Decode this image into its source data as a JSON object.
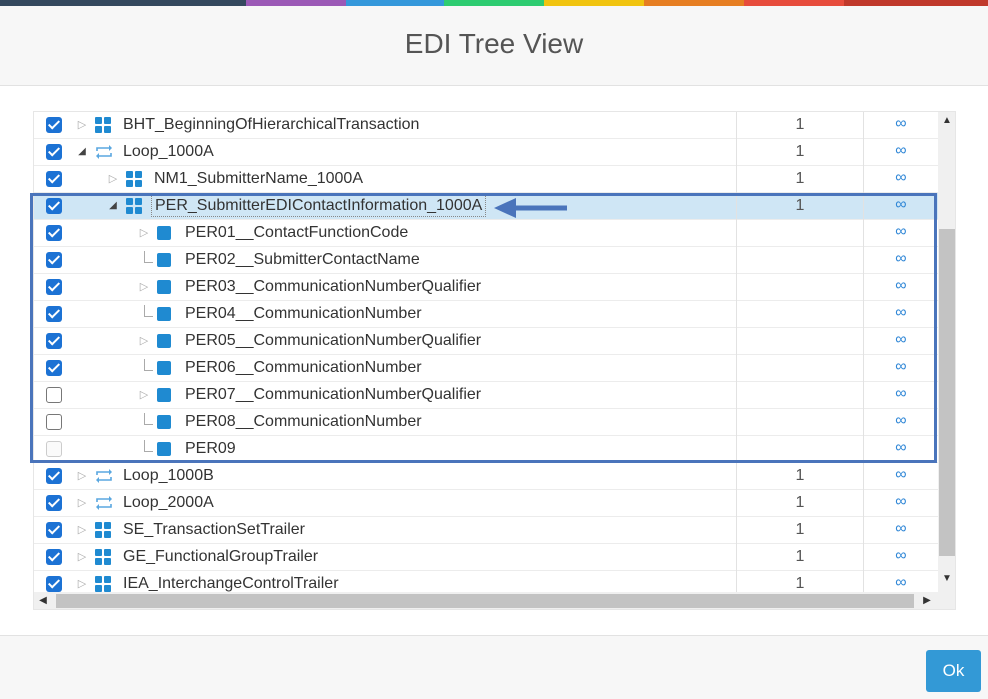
{
  "dialog": {
    "title": "EDI Tree View",
    "ok_label": "Ok"
  },
  "topbar_colors": [
    "#34495e",
    "#34495e",
    "#9b59b6",
    "#3498db",
    "#2ecc71",
    "#f1c40f",
    "#e67e22",
    "#e74c3c",
    "#c0392b"
  ],
  "rows": [
    {
      "name": "BHT_BeginningOfHierarchicalTransaction",
      "count": "1",
      "link": "∞",
      "checkbox": "checked",
      "node": "segment",
      "expander": "collapsed",
      "selected": false
    },
    {
      "name": "Loop_1000A",
      "count": "1",
      "link": "∞",
      "checkbox": "checked",
      "node": "loop",
      "expander": "expanded",
      "selected": false
    },
    {
      "name": "NM1_SubmitterName_1000A",
      "count": "1",
      "link": "∞",
      "checkbox": "checked",
      "node": "segment",
      "expander": "collapsed",
      "selected": false
    },
    {
      "name": "PER_SubmitterEDIContactInformation_1000A",
      "count": "1",
      "link": "∞",
      "checkbox": "checked",
      "node": "segment",
      "expander": "expanded",
      "selected": true
    },
    {
      "name": "PER01__ContactFunctionCode",
      "count": "",
      "link": "∞",
      "checkbox": "checked",
      "node": "element",
      "expander": "collapsed",
      "selected": false
    },
    {
      "name": "PER02__SubmitterContactName",
      "count": "",
      "link": "∞",
      "checkbox": "checked",
      "node": "element",
      "expander": "leaf",
      "selected": false
    },
    {
      "name": "PER03__CommunicationNumberQualifier",
      "count": "",
      "link": "∞",
      "checkbox": "checked",
      "node": "element",
      "expander": "collapsed",
      "selected": false
    },
    {
      "name": "PER04__CommunicationNumber",
      "count": "",
      "link": "∞",
      "checkbox": "checked",
      "node": "element",
      "expander": "leaf",
      "selected": false
    },
    {
      "name": "PER05__CommunicationNumberQualifier",
      "count": "",
      "link": "∞",
      "checkbox": "checked",
      "node": "element",
      "expander": "collapsed",
      "selected": false
    },
    {
      "name": "PER06__CommunicationNumber",
      "count": "",
      "link": "∞",
      "checkbox": "checked",
      "node": "element",
      "expander": "leaf",
      "selected": false
    },
    {
      "name": "PER07__CommunicationNumberQualifier",
      "count": "",
      "link": "∞",
      "checkbox": "unchecked",
      "node": "element",
      "expander": "collapsed",
      "selected": false
    },
    {
      "name": "PER08__CommunicationNumber",
      "count": "",
      "link": "∞",
      "checkbox": "unchecked",
      "node": "element",
      "expander": "leaf",
      "selected": false
    },
    {
      "name": "PER09",
      "count": "",
      "link": "∞",
      "checkbox": "disabled",
      "node": "element",
      "expander": "leaf",
      "selected": false
    },
    {
      "name": "Loop_1000B",
      "count": "1",
      "link": "∞",
      "checkbox": "checked",
      "node": "loop",
      "expander": "collapsed",
      "selected": false
    },
    {
      "name": "Loop_2000A",
      "count": "1",
      "link": "∞",
      "checkbox": "checked",
      "node": "loop",
      "expander": "collapsed",
      "selected": false
    },
    {
      "name": "SE_TransactionSetTrailer",
      "count": "1",
      "link": "∞",
      "checkbox": "checked",
      "node": "segment",
      "expander": "collapsed",
      "selected": false
    },
    {
      "name": "GE_FunctionalGroupTrailer",
      "count": "1",
      "link": "∞",
      "checkbox": "checked",
      "node": "segment",
      "expander": "collapsed",
      "selected": false
    },
    {
      "name": "IEA_InterchangeControlTrailer",
      "count": "1",
      "link": "∞",
      "checkbox": "checked",
      "node": "segment",
      "expander": "collapsed",
      "selected": false
    }
  ]
}
